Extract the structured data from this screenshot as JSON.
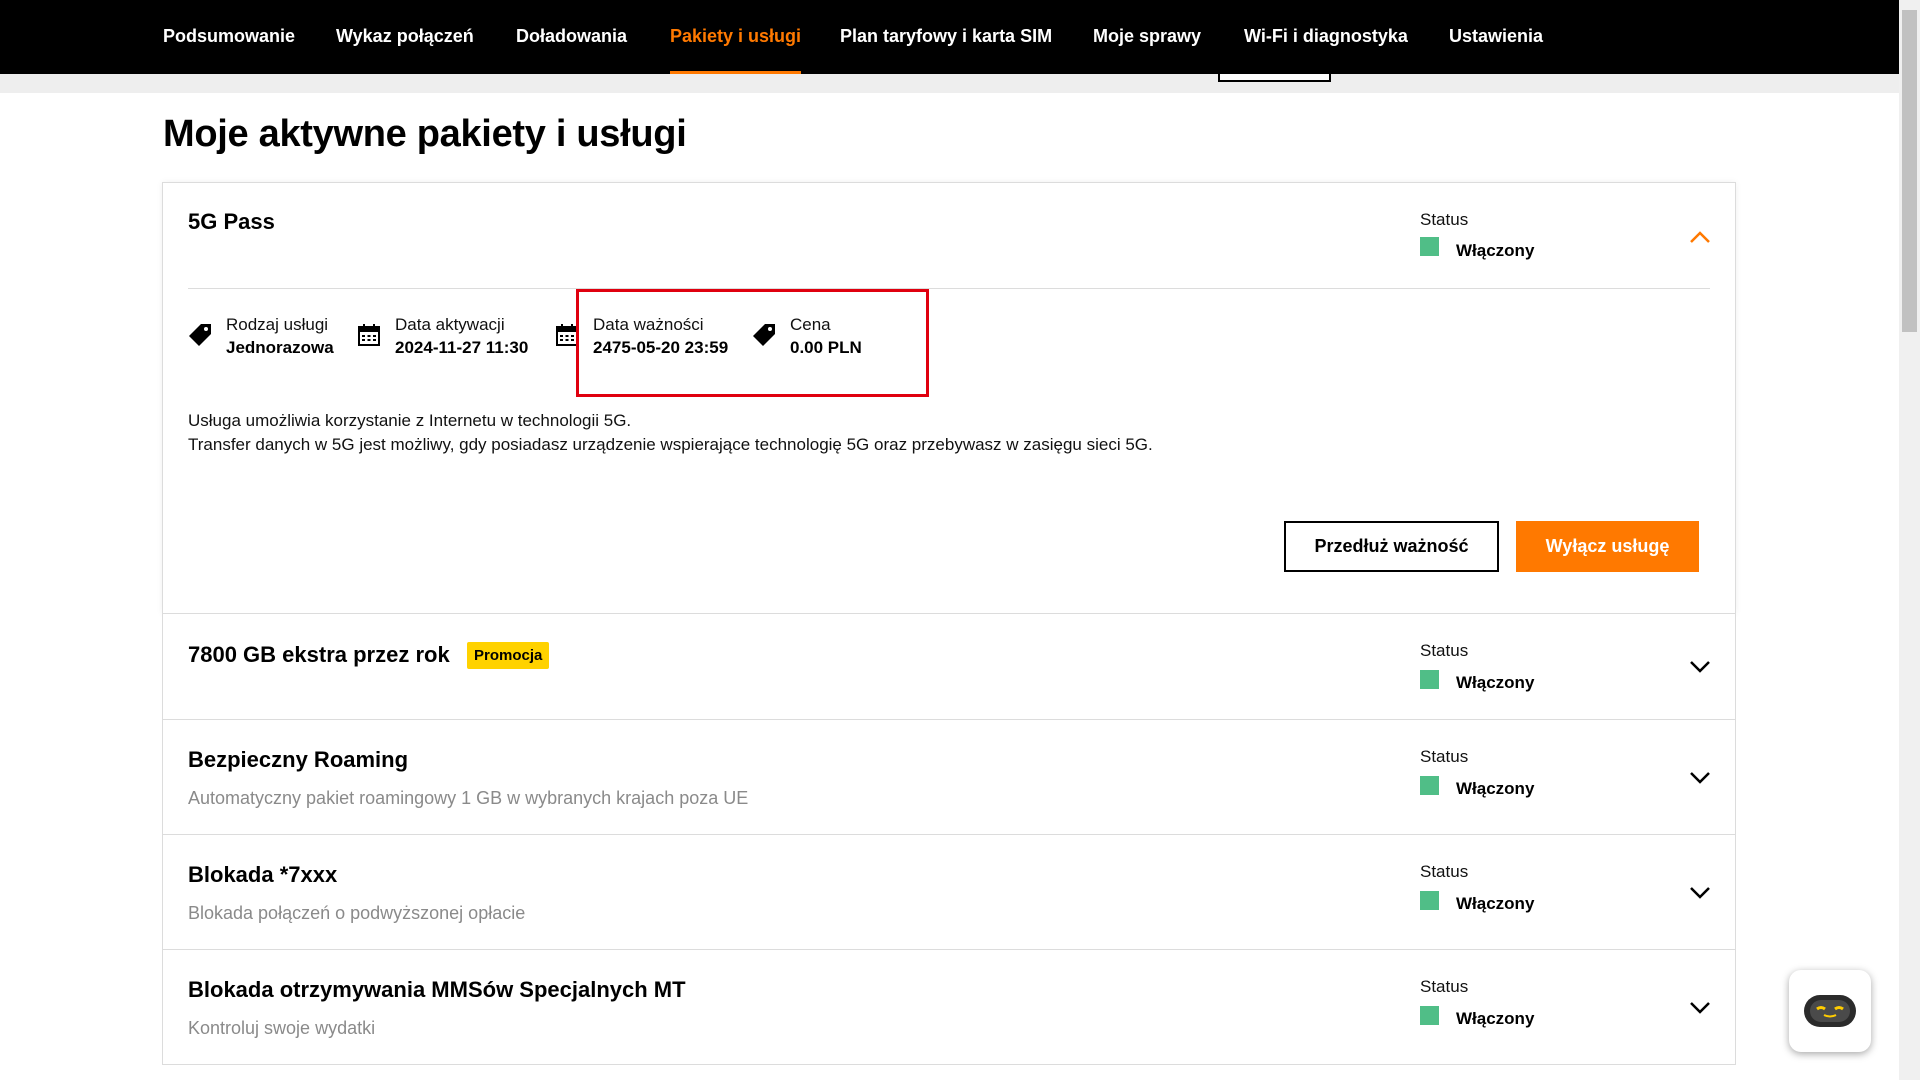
{
  "nav": {
    "items": [
      {
        "label": "Podsumowanie"
      },
      {
        "label": "Wykaz połączeń"
      },
      {
        "label": "Doładowania"
      },
      {
        "label": "Pakiety i usługi"
      },
      {
        "label": "Plan taryfowy i karta SIM"
      },
      {
        "label": "Moje sprawy"
      },
      {
        "label": "Wi-Fi i diagnostyka"
      },
      {
        "label": "Ustawienia"
      }
    ],
    "active": "Pakiety i usługi"
  },
  "page_title": "Moje aktywne pakiety i usługi",
  "status_color": "#50be87",
  "accent_color": "#ff7900",
  "packages": [
    {
      "title": "5G Pass",
      "status_label": "Status",
      "status_value": "Włączony",
      "expanded": true,
      "details": [
        {
          "icon": "tag-icon",
          "label": "Rodzaj usługi",
          "value": "Jednorazowa"
        },
        {
          "icon": "calendar-icon",
          "label": "Data aktywacji",
          "value": "2024-11-27 11:30"
        },
        {
          "icon": "calendar-icon",
          "label": "Data ważności",
          "value": "2475-05-20 23:59"
        },
        {
          "icon": "tag-icon",
          "label": "Cena",
          "value": "0.00 PLN"
        }
      ],
      "description": [
        "Usługa umożliwia korzystanie z Internetu w technologii 5G.",
        "Transfer danych w 5G jest możliwy, gdy posiadasz urządzenie wspierające technologię 5G oraz przebywasz w zasięgu sieci 5G."
      ],
      "buttons": {
        "extend": "Przedłuż ważność",
        "disable": "Wyłącz usługę"
      }
    },
    {
      "title": "7800 GB ekstra przez rok",
      "badge": "Promocja",
      "status_label": "Status",
      "status_value": "Włączony"
    },
    {
      "title": "Bezpieczny Roaming",
      "subtitle": "Automatyczny pakiet roamingowy 1 GB w wybranych krajach poza UE",
      "status_label": "Status",
      "status_value": "Włączony"
    },
    {
      "title": "Blokada *7xxx",
      "subtitle": "Blokada połączeń o podwyższonej opłacie",
      "status_label": "Status",
      "status_value": "Włączony"
    },
    {
      "title": "Blokada otrzymywania MMSów Specjalnych MT",
      "subtitle": "Kontroluj swoje wydatki",
      "status_label": "Status",
      "status_value": "Włączony"
    }
  ]
}
